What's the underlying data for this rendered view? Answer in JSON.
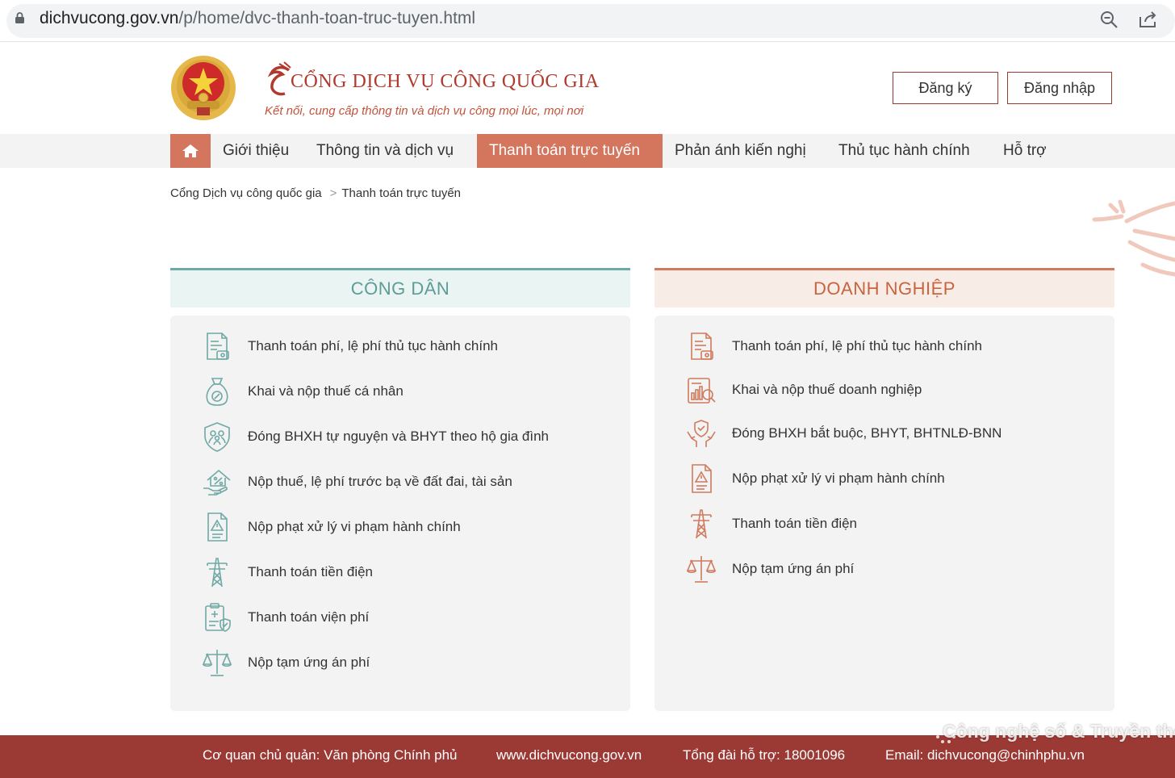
{
  "browser": {
    "url_host": "dichvucong.gov.vn",
    "url_path": "/p/home/dvc-thanh-toan-truc-tuyen.html"
  },
  "header": {
    "title": "CỔNG DỊCH VỤ CÔNG QUỐC GIA",
    "tagline": "Kết nối, cung cấp thông tin và dịch vụ công mọi lúc, mọi nơi",
    "register": "Đăng ký",
    "login": "Đăng nhập"
  },
  "nav": {
    "items": [
      "Giới thiệu",
      "Thông tin và dịch vụ",
      "Thanh toán trực tuyến",
      "Phản ánh kiến nghị",
      "Thủ tục hành chính",
      "Hỗ trợ"
    ],
    "active": "Thanh toán trực tuyến"
  },
  "breadcrumb": {
    "home": "Cổng Dịch vụ công quốc gia",
    "separator": ">",
    "current": "Thanh toán trực tuyến"
  },
  "citizen": {
    "title": "CÔNG DÂN",
    "accent": "#6fa9a5",
    "items": [
      {
        "label": "Thanh toán phí, lệ phí thủ tục hành chính",
        "icon": "fee-document-icon"
      },
      {
        "label": "Khai và nộp thuế cá nhân",
        "icon": "tax-bag-icon"
      },
      {
        "label": "Đóng BHXH tự nguyện và BHYT theo hộ gia đình",
        "icon": "family-shield-icon"
      },
      {
        "label": "Nộp thuế, lệ phí trước bạ về đất đai, tài sản",
        "icon": "house-hand-icon"
      },
      {
        "label": "Nộp phạt xử lý vi phạm hành chính",
        "icon": "warning-document-icon"
      },
      {
        "label": "Thanh toán tiền điện",
        "icon": "power-tower-icon"
      },
      {
        "label": "Thanh toán viện phí",
        "icon": "medical-clipboard-icon"
      },
      {
        "label": "Nộp tạm ứng án phí",
        "icon": "scales-icon"
      }
    ]
  },
  "business": {
    "title": "DOANH NGHIỆP",
    "accent": "#d07a5f",
    "items": [
      {
        "label": "Thanh toán phí, lệ phí thủ tục hành chính",
        "icon": "fee-document-icon"
      },
      {
        "label": "Khai và nộp thuế doanh nghiệp",
        "icon": "business-tax-icon"
      },
      {
        "label": "Đóng BHXH bắt buộc, BHYT, BHTNLĐ-BNN",
        "icon": "hands-shield-icon"
      },
      {
        "label": "Nộp phạt xử lý vi phạm hành chính",
        "icon": "warning-document-icon"
      },
      {
        "label": "Thanh toán tiền điện",
        "icon": "power-tower-icon"
      },
      {
        "label": "Nộp tạm ứng án phí",
        "icon": "scales-icon"
      }
    ]
  },
  "footer": {
    "agency": "Cơ quan chủ quản: Văn phòng Chính phủ",
    "website": "www.dichvucong.gov.vn",
    "hotline": "Tổng đài hỗ trợ: 18001096",
    "email": "Email: dichvucong@chinhphu.vn"
  },
  "watermark": "Công nghệ số & Truyền thông"
}
